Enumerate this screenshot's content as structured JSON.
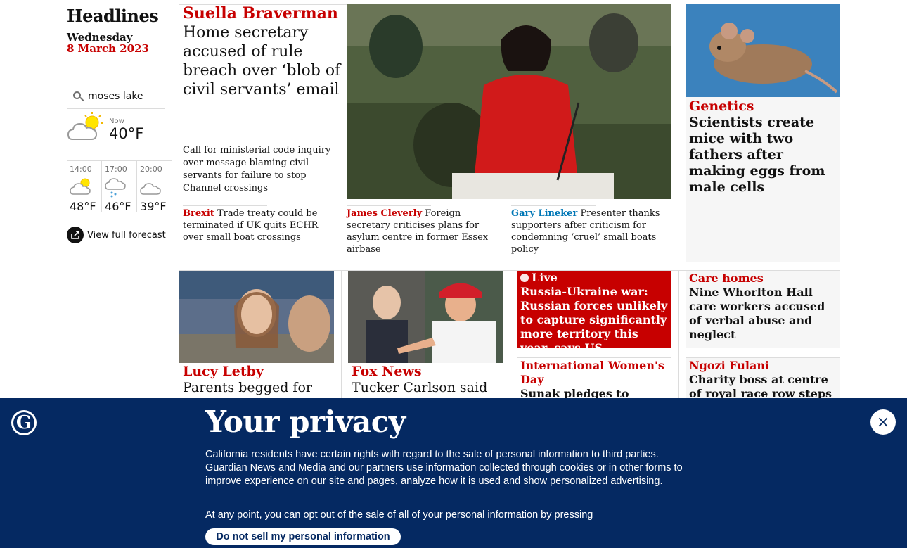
{
  "left": {
    "title": "Headlines",
    "weekday": "Wednesday",
    "date": "8 March 2023"
  },
  "weather": {
    "location": "moses lake",
    "now_label": "Now",
    "now_temp": "40°F",
    "now_icon": "partly-cloudy-icon",
    "forecast": [
      {
        "time": "14:00",
        "temp": "48°F",
        "icon": "partly-sunny-icon"
      },
      {
        "time": "17:00",
        "temp": "46°F",
        "icon": "rain-cloud-icon"
      },
      {
        "time": "20:00",
        "temp": "39°F",
        "icon": "cloud-icon"
      }
    ],
    "full_forecast_label": "View full forecast"
  },
  "main_story": {
    "kicker": "Suella Braverman",
    "headline": "Home secretary accused of rule breach over ‘blob of civil servants’ email",
    "standfirst": "Call for ministerial code inquiry over message blaming civil servants for failure to stop Channel crossings"
  },
  "sublinks": [
    {
      "kicker": "Brexit",
      "text": "Trade treaty could be terminated if UK quits ECHR over small boat crossings"
    },
    {
      "kicker": "James Cleverly",
      "text": "Foreign secretary criticises plans for asylum centre in former Essex airbase"
    },
    {
      "kicker": "Gary Lineker",
      "text": "Presenter thanks supporters after criticism for condemning ‘cruel’ small boats policy"
    }
  ],
  "right_top": {
    "kicker": "Genetics",
    "headline": "Scientists create mice with two fathers after making eggs from male cells"
  },
  "row2": {
    "card1": {
      "kicker": "Lucy Letby",
      "headline": "Parents begged for"
    },
    "card2": {
      "kicker": "Fox News",
      "headline": "Tucker Carlson said he"
    },
    "live": {
      "label": "Live",
      "headline": "Russia-Ukraine war: Russian forces unlikely to capture significantly more territory this year, says US"
    },
    "iwd": {
      "kicker": "International Women's Day",
      "headline": "Sunak pledges to ‘build on"
    },
    "care": {
      "kicker": "Care homes",
      "headline": "Nine Whorlton Hall care workers accused of verbal abuse and neglect"
    },
    "fulani": {
      "kicker": "Ngozi Fulani",
      "headline": "Charity boss at centre of royal race row steps down"
    }
  },
  "privacy": {
    "title": "Your privacy",
    "body": "California residents have certain rights with regard to the sale of personal information to third parties. Guardian News and Media and our partners use information collected through cookies or in other forms to improve experience on our site and pages, analyze how it is used and show personalized advertising.",
    "body2": "At any point, you can opt out of the sale of all of your personal information by pressing",
    "button": "Do not sell my personal information",
    "close": "×",
    "logo_letter": "G"
  },
  "colors": {
    "accent": "#c70000",
    "link_blue": "#0077b6",
    "banner": "#052962"
  }
}
